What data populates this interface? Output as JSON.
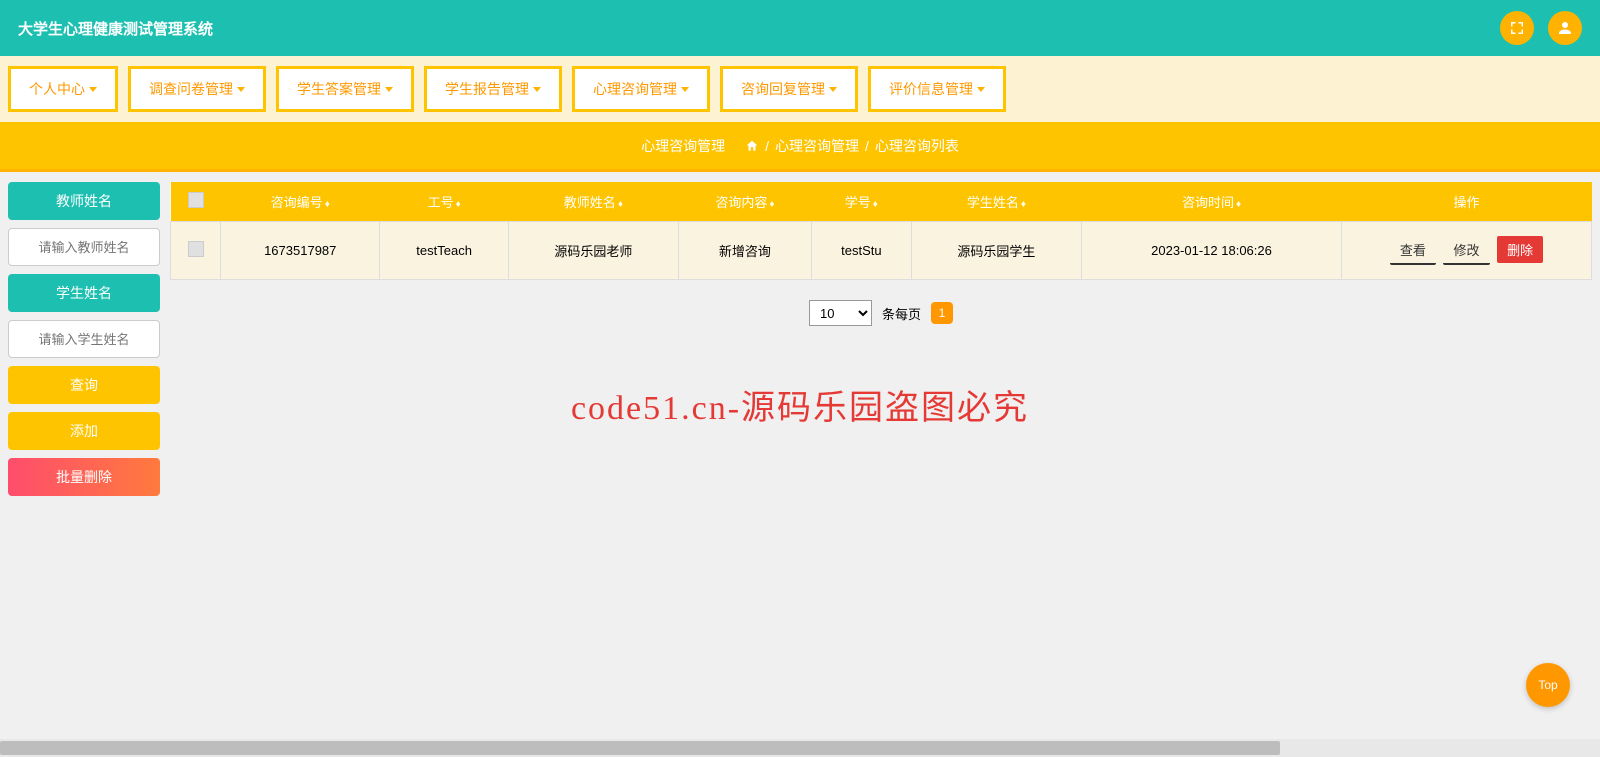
{
  "header": {
    "title": "大学生心理健康测试管理系统"
  },
  "nav": {
    "items": [
      "个人中心",
      "调查问卷管理",
      "学生答案管理",
      "学生报告管理",
      "心理咨询管理",
      "咨询回复管理",
      "评价信息管理"
    ]
  },
  "breadcrumb": {
    "main": "心理咨询管理",
    "path1": "心理咨询管理",
    "path2": "心理咨询列表",
    "sep": "/"
  },
  "sidebar": {
    "teacher_label": "教师姓名",
    "teacher_placeholder": "请输入教师姓名",
    "student_label": "学生姓名",
    "student_placeholder": "请输入学生姓名",
    "query": "查询",
    "add": "添加",
    "batch_delete": "批量删除"
  },
  "table": {
    "headers": [
      "",
      "咨询编号",
      "工号",
      "教师姓名",
      "咨询内容",
      "学号",
      "学生姓名",
      "咨询时间",
      "操作"
    ],
    "rows": [
      {
        "consult_no": "1673517987",
        "job_no": "testTeach",
        "teacher_name": "源码乐园老师",
        "content": "新增咨询",
        "student_no": "testStu",
        "student_name": "源码乐园学生",
        "time": "2023-01-12 18:06:26"
      }
    ],
    "actions": {
      "view": "查看",
      "edit": "修改",
      "delete": "删除"
    }
  },
  "pagination": {
    "per_page_value": "10",
    "per_page_label": "条每页",
    "current": "1"
  },
  "watermark": "code51.cn-源码乐园盗图必究",
  "top_btn": "Top"
}
